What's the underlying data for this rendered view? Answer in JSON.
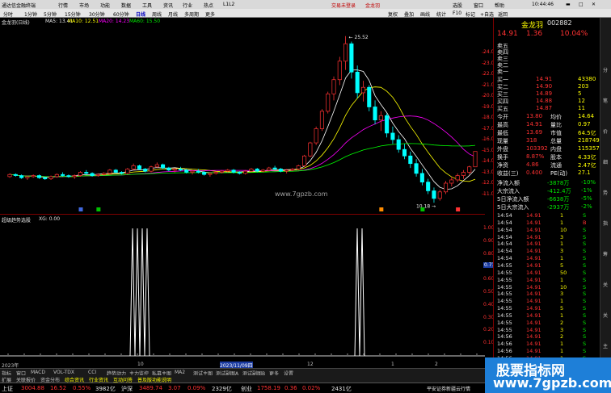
{
  "titlebar": {
    "app_name": "通达信金融终端",
    "menus": [
      "行情",
      "市场",
      "功能",
      "数据",
      "工具",
      "资讯",
      "行业",
      "热点",
      "L1L2"
    ],
    "login_text": "交易未登录",
    "stock_name": "金龙羽",
    "right_menus": [
      "选股",
      "窗口",
      "帮助"
    ]
  },
  "toolbar": {
    "periods": [
      "分时",
      "1分钟",
      "5分钟",
      "15分钟",
      "30分钟",
      "60分钟",
      "日线",
      "周线",
      "月线",
      "多周期",
      "更多"
    ],
    "active_period": "日线",
    "right_items": [
      "复权",
      "叠加",
      "画线",
      "统计",
      "F10",
      "标记",
      "+自选",
      "返回"
    ]
  },
  "stockhdr": {
    "title": "金龙羽(日线)",
    "ma5": "MA5: 13.41",
    "ma10": "MA10: 12.51",
    "ma20": "MA20: 14.23",
    "ma60": "MA60: 15.50"
  },
  "chart_axis": {
    "price_ticks": [
      "24.00",
      "23.00",
      "22.00",
      "21.00",
      "20.00",
      "19.00",
      "18.00",
      "17.00",
      "16.00",
      "15.00",
      "14.00",
      "13.00",
      "12.00",
      "11.00"
    ],
    "high_label": "25.52",
    "low_label": "10.18",
    "ind_ticks": [
      "1.00",
      "0.90",
      "0.80",
      "0.70",
      "0.60",
      "0.50",
      "0.40",
      "0.30",
      "0.20",
      "0.10"
    ],
    "ind_cursor": "0.71"
  },
  "indicator": {
    "name": "超级趋势选股",
    "value": "XG: 0.00"
  },
  "center_watermark": "www.7gpzb.com",
  "datestrip": {
    "labels": [
      "2023年",
      "10",
      "2023/11/09四",
      "12",
      "1",
      "2"
    ]
  },
  "tabs1": [
    "指标",
    "窗口",
    "MACD",
    "VOL-TDX",
    "CCI",
    "趋势动力",
    "主力监控",
    "私募主图",
    "MA2",
    "测试主图",
    "测试副图A",
    "测试副图B",
    "更多",
    "设置"
  ],
  "tabs2": [
    "扩展",
    "关联报价",
    "资金分布",
    "综合资讯",
    "行业资讯",
    "互动问答",
    "普及版功能说明"
  ],
  "statusbar": {
    "items": [
      {
        "label": "上证",
        "val": "3004.88",
        "chg": "16.52",
        "pct": "0.55%",
        "amt": "3982亿"
      },
      {
        "label": "沪深",
        "val": "3489.74",
        "chg": "3.07",
        "pct": "0.09%",
        "amt": "2329亿"
      },
      {
        "label": "创业",
        "val": "1758.19",
        "chg": "0.36",
        "pct": "0.02%",
        "amt": "2431亿"
      }
    ],
    "right_text": "平安证券新疆云行情"
  },
  "quote": {
    "name": "金龙羽",
    "code": "002882",
    "price": "14.91",
    "change": "1.36",
    "pct": "10.04%",
    "asks": [
      {
        "label": "卖五",
        "price": "",
        "vol": ""
      },
      {
        "label": "卖四",
        "price": "",
        "vol": ""
      },
      {
        "label": "卖三",
        "price": "",
        "vol": ""
      },
      {
        "label": "卖二",
        "price": "",
        "vol": ""
      },
      {
        "label": "卖一",
        "price": "",
        "vol": ""
      }
    ],
    "bids": [
      {
        "label": "买一",
        "price": "14.91",
        "vol": "43380"
      },
      {
        "label": "买二",
        "price": "14.90",
        "vol": "203"
      },
      {
        "label": "买三",
        "price": "14.89",
        "vol": "5"
      },
      {
        "label": "买四",
        "price": "14.88",
        "vol": "12"
      },
      {
        "label": "买五",
        "price": "14.87",
        "vol": "11"
      }
    ],
    "stats": [
      {
        "l1": "今开",
        "v1": "13.80",
        "l2": "均价",
        "v2": "14.64"
      },
      {
        "l1": "最高",
        "v1": "14.91",
        "l2": "量比",
        "v2": "0.97"
      },
      {
        "l1": "最低",
        "v1": "13.69",
        "l2": "市值",
        "v2": "64.5亿"
      },
      {
        "l1": "现量",
        "v1": "318",
        "l2": "总量",
        "v2": "218749"
      },
      {
        "l1": "外盘",
        "v1": "103392",
        "l2": "内盘",
        "v2": "115357"
      },
      {
        "l1": "换手",
        "v1": "8.87%",
        "l2": "股本",
        "v2": "4.33亿"
      },
      {
        "l1": "净资",
        "v1": "4.86",
        "l2": "流通",
        "v2": "2.47亿"
      },
      {
        "l1": "收益(三)",
        "v1": "0.400",
        "l2": "PE(动)",
        "v2": "27.1"
      }
    ],
    "flows": [
      {
        "label": "净流入额",
        "val": "-3878万",
        "pct": "-10%"
      },
      {
        "label": "大宗流入",
        "val": "-412.4万",
        "pct": "-1%"
      },
      {
        "label": "5日净流入额",
        "val": "-6638万",
        "pct": "-5%"
      },
      {
        "label": "5日大宗流入",
        "val": "-2937万",
        "pct": "-2%"
      }
    ],
    "ticks": [
      {
        "time": "14:54",
        "price": "14.91",
        "vol": "1",
        "side": "S"
      },
      {
        "time": "14:54",
        "price": "14.91",
        "vol": "1",
        "side": "B"
      },
      {
        "time": "14:54",
        "price": "14.91",
        "vol": "10",
        "side": "S"
      },
      {
        "time": "14:54",
        "price": "14.91",
        "vol": "3",
        "side": "S"
      },
      {
        "time": "14:54",
        "price": "14.91",
        "vol": "1",
        "side": "S"
      },
      {
        "time": "14:54",
        "price": "14.91",
        "vol": "3",
        "side": "S"
      },
      {
        "time": "14:54",
        "price": "14.91",
        "vol": "1",
        "side": "S"
      },
      {
        "time": "14:55",
        "price": "14.91",
        "vol": "5",
        "side": "S"
      },
      {
        "time": "14:55",
        "price": "14.91",
        "vol": "50",
        "side": "S"
      },
      {
        "time": "14:55",
        "price": "14.91",
        "vol": "1",
        "side": "S"
      },
      {
        "time": "14:55",
        "price": "14.91",
        "vol": "10",
        "side": "S"
      },
      {
        "time": "14:55",
        "price": "14.91",
        "vol": "3",
        "side": "S"
      },
      {
        "time": "14:55",
        "price": "14.91",
        "vol": "1",
        "side": "S"
      },
      {
        "time": "14:55",
        "price": "14.91",
        "vol": "5",
        "side": "S"
      },
      {
        "time": "14:55",
        "price": "14.91",
        "vol": "1",
        "side": "S"
      },
      {
        "time": "14:55",
        "price": "14.91",
        "vol": "2",
        "side": "S"
      },
      {
        "time": "14:55",
        "price": "14.91",
        "vol": "3",
        "side": "S"
      },
      {
        "time": "14:56",
        "price": "14.91",
        "vol": "2",
        "side": "S"
      },
      {
        "time": "14:56",
        "price": "14.91",
        "vol": "1",
        "side": "S"
      },
      {
        "time": "14:56",
        "price": "14.91",
        "vol": "1",
        "side": "S"
      },
      {
        "time": "14:56",
        "price": "14.91",
        "vol": "1",
        "side": "S"
      },
      {
        "time": "14:56",
        "price": "14.91",
        "vol": "1",
        "side": "S"
      },
      {
        "time": "14:56",
        "price": "14.91",
        "vol": "1",
        "side": "S"
      }
    ]
  },
  "scroll_labels": [
    "分",
    "笔",
    "价",
    "细",
    "势",
    "指",
    "筹",
    "关",
    "关",
    "主"
  ],
  "watermark": {
    "line1": "股票指标网",
    "line2": "www.7gpzb.com"
  },
  "colors": {
    "up": "#ff3232",
    "down": "#00ffff",
    "ma5": "#ffffff",
    "ma10": "#ffff00",
    "ma20": "#ff00ff",
    "ma60": "#00ff00"
  },
  "chart_data": {
    "type": "candlestick",
    "y_range": [
      10,
      26
    ],
    "candles": [
      [
        12.6,
        12.9,
        12.5,
        12.8
      ],
      [
        12.8,
        12.9,
        12.6,
        12.7
      ],
      [
        12.7,
        12.8,
        12.4,
        12.5
      ],
      [
        12.5,
        12.7,
        12.3,
        12.6
      ],
      [
        12.6,
        12.8,
        12.5,
        12.7
      ],
      [
        12.7,
        12.8,
        12.4,
        12.5
      ],
      [
        12.5,
        12.6,
        12.3,
        12.4
      ],
      [
        12.4,
        12.7,
        12.3,
        12.6
      ],
      [
        12.6,
        12.9,
        12.5,
        12.8
      ],
      [
        12.8,
        13.0,
        12.6,
        12.7
      ],
      [
        12.7,
        12.8,
        12.5,
        12.6
      ],
      [
        12.6,
        12.8,
        12.4,
        12.7
      ],
      [
        12.7,
        13.1,
        12.6,
        13.0
      ],
      [
        13.0,
        13.2,
        12.8,
        12.9
      ],
      [
        12.9,
        13.0,
        12.6,
        12.7
      ],
      [
        12.7,
        12.9,
        12.6,
        12.8
      ],
      [
        12.8,
        13.0,
        12.7,
        12.9
      ],
      [
        12.9,
        13.3,
        12.8,
        13.2
      ],
      [
        13.2,
        13.3,
        12.9,
        13.0
      ],
      [
        13.0,
        13.1,
        12.8,
        12.9
      ],
      [
        12.9,
        13.4,
        12.8,
        13.3
      ],
      [
        13.3,
        13.8,
        13.2,
        13.6
      ],
      [
        13.6,
        13.7,
        13.2,
        13.3
      ],
      [
        13.3,
        13.4,
        13.0,
        13.1
      ],
      [
        13.1,
        13.6,
        13.0,
        13.5
      ],
      [
        13.5,
        13.9,
        13.4,
        13.7
      ],
      [
        13.7,
        13.8,
        13.3,
        13.4
      ],
      [
        13.4,
        13.5,
        13.1,
        13.2
      ],
      [
        13.2,
        13.4,
        13.0,
        13.3
      ],
      [
        13.3,
        13.5,
        13.1,
        13.2
      ],
      [
        13.2,
        13.3,
        12.9,
        13.0
      ],
      [
        13.0,
        13.2,
        12.8,
        13.1
      ],
      [
        13.1,
        13.3,
        12.9,
        13.0
      ],
      [
        13.0,
        13.1,
        12.7,
        12.8
      ],
      [
        12.8,
        13.0,
        12.6,
        12.9
      ],
      [
        12.9,
        13.1,
        12.8,
        13.0
      ],
      [
        13.0,
        13.2,
        12.9,
        13.1
      ],
      [
        13.1,
        13.3,
        13.0,
        13.2
      ],
      [
        13.2,
        13.3,
        12.9,
        13.0
      ],
      [
        13.0,
        13.1,
        12.8,
        12.9
      ],
      [
        12.9,
        13.2,
        12.8,
        13.1
      ],
      [
        13.1,
        13.4,
        13.0,
        13.3
      ],
      [
        13.3,
        13.4,
        13.0,
        13.1
      ],
      [
        13.1,
        13.3,
        13.0,
        13.2
      ],
      [
        13.2,
        13.5,
        13.1,
        13.4
      ],
      [
        13.4,
        13.6,
        13.2,
        13.3
      ],
      [
        13.3,
        13.4,
        13.0,
        13.1
      ],
      [
        13.1,
        13.3,
        12.9,
        13.2
      ],
      [
        13.2,
        13.4,
        13.1,
        13.3
      ],
      [
        13.3,
        13.7,
        13.2,
        13.6
      ],
      [
        13.6,
        14.6,
        13.5,
        14.5
      ],
      [
        14.5,
        15.8,
        14.4,
        15.7
      ],
      [
        15.7,
        17.2,
        15.5,
        17.0
      ],
      [
        17.0,
        18.8,
        16.8,
        18.6
      ],
      [
        18.6,
        20.4,
        18.4,
        20.2
      ],
      [
        20.2,
        21.8,
        19.6,
        21.5
      ],
      [
        21.5,
        23.6,
        21.0,
        23.2
      ],
      [
        23.2,
        25.5,
        22.4,
        24.8
      ],
      [
        24.8,
        25.0,
        21.6,
        22.2
      ],
      [
        22.2,
        22.8,
        19.8,
        20.3
      ],
      [
        20.3,
        21.4,
        19.5,
        20.8
      ],
      [
        20.8,
        21.0,
        18.6,
        19.0
      ],
      [
        19.0,
        19.6,
        17.4,
        17.8
      ],
      [
        17.8,
        18.6,
        16.8,
        18.2
      ],
      [
        18.2,
        18.4,
        16.2,
        16.6
      ],
      [
        16.6,
        17.2,
        15.6,
        16.0
      ],
      [
        16.0,
        16.4,
        14.8,
        15.1
      ],
      [
        15.1,
        15.6,
        14.2,
        14.5
      ],
      [
        14.5,
        14.9,
        13.4,
        13.8
      ],
      [
        13.8,
        14.2,
        12.6,
        12.9
      ],
      [
        12.9,
        13.3,
        11.8,
        12.1
      ],
      [
        12.1,
        12.4,
        11.0,
        11.3
      ],
      [
        11.3,
        11.6,
        10.2,
        10.6
      ],
      [
        10.6,
        11.4,
        10.4,
        11.2
      ],
      [
        11.2,
        12.2,
        11.0,
        12.0
      ],
      [
        12.0,
        12.6,
        11.7,
        12.3
      ],
      [
        12.3,
        12.9,
        12.1,
        12.7
      ],
      [
        12.7,
        13.2,
        12.4,
        13.0
      ],
      [
        13.0,
        13.6,
        12.8,
        13.5
      ],
      [
        13.5,
        14.91,
        13.5,
        14.91
      ]
    ]
  }
}
